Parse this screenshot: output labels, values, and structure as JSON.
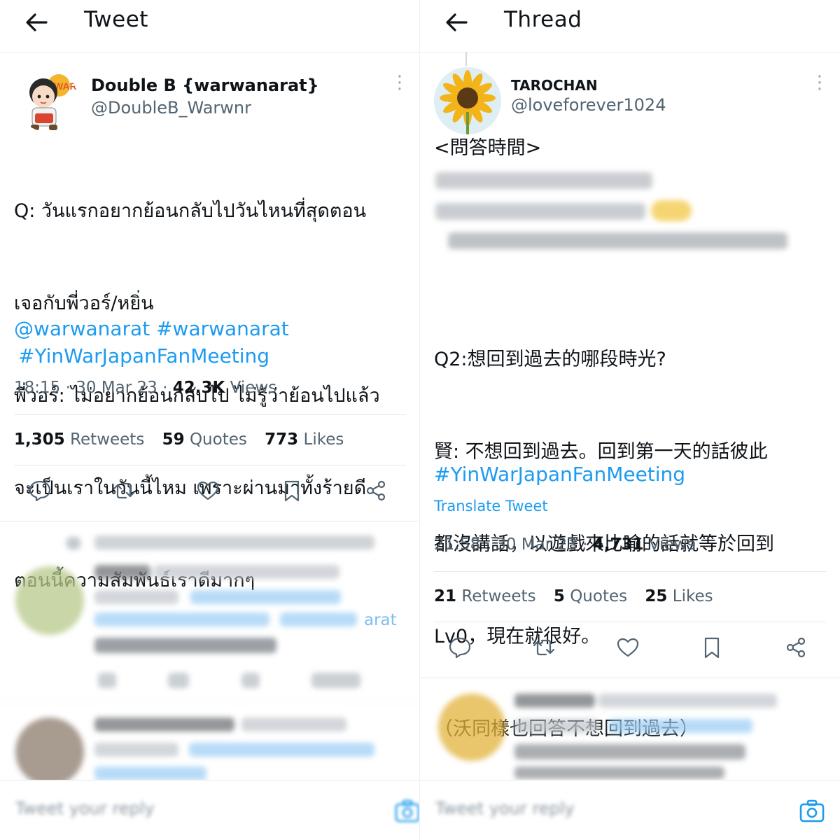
{
  "left": {
    "header": {
      "title": "Tweet"
    },
    "author": {
      "name": "Double B {warwanarat}",
      "handle": "@DoubleB_Warwnr"
    },
    "body_lines": [
      "Q: วันแรกอยากย้อนกลับไปวันไหนที่สุดตอน",
      "เจอกับพี่วอร์/หยิ่น",
      "พี่วอร์: ไม่อยากย้อนกลับไป ไม่รู้ว่าย้อนไปแล้ว",
      "จะเป็นเราในวันนี้ไหม เพราะผ่านมาทั้งร้ายดี",
      "ตอนนี้ความสัมพันธ์เราดีมากๆ"
    ],
    "tags_line1": "@warwanarat #warwanarat",
    "tags_line2": "#YinWarJapanFanMeeting",
    "meta": {
      "time": "18:15 · 30 Mar 23 · ",
      "views_count": "42.3K",
      "views_label": " Views"
    },
    "stats": {
      "retweets_count": "1,305",
      "retweets_label": "Retweets",
      "quotes_count": "59",
      "quotes_label": "Quotes",
      "likes_count": "773",
      "likes_label": "Likes"
    },
    "reply_placeholder": "Tweet your reply",
    "blurred_reply": {
      "partial_text": "arat"
    }
  },
  "right": {
    "header": {
      "title": "Thread"
    },
    "author": {
      "name": "TAROCHAN",
      "handle": "@loveforever1024"
    },
    "body_line1": "<問答時間>",
    "body_lines2": [
      "Q2:想回到過去的哪段時光?",
      "賢: 不想回到過去。回到第一天的話彼此",
      "都沒講話，以遊戲來比喻的話就等於回到",
      "Lv0，現在就很好。",
      "（沃同樣也回答不想回到過去）"
    ],
    "hashtag": "#YinWarJapanFanMeeting",
    "translate": "Translate Tweet",
    "meta": {
      "time": "21:58 · 30 Mar 23 · ",
      "views_count": "4,731",
      "views_label": " Views"
    },
    "stats": {
      "retweets_count": "21",
      "retweets_label": "Retweets",
      "quotes_count": "5",
      "quotes_label": "Quotes",
      "likes_count": "25",
      "likes_label": "Likes"
    },
    "reply_placeholder": "Tweet your reply"
  },
  "icons": [
    "back-arrow-icon",
    "more-icon",
    "reply-icon",
    "retweet-icon",
    "like-icon",
    "bookmark-icon",
    "share-icon",
    "camera-icon"
  ],
  "colors": {
    "link": "#1d9bf0",
    "text": "#0f1419",
    "secondary": "#536471"
  }
}
